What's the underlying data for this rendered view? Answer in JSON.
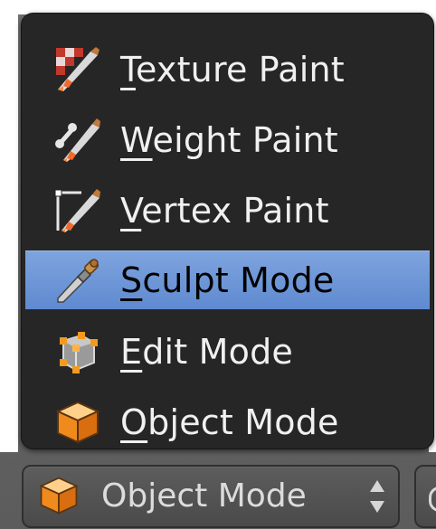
{
  "menu": {
    "items": [
      {
        "underline": "T",
        "rest": "exture Paint",
        "icon": "texture-paint-icon",
        "active": false
      },
      {
        "underline": "W",
        "rest": "eight Paint",
        "icon": "weight-paint-icon",
        "active": false
      },
      {
        "underline": "V",
        "rest": "ertex Paint",
        "icon": "vertex-paint-icon",
        "active": false
      },
      {
        "underline": "S",
        "rest": "culpt Mode",
        "icon": "sculpt-mode-icon",
        "active": true
      },
      {
        "underline": "E",
        "rest": "dit Mode",
        "icon": "edit-mode-icon",
        "active": false
      },
      {
        "underline": "O",
        "rest": "bject Mode",
        "icon": "object-mode-icon",
        "active": false
      }
    ]
  },
  "header": {
    "mode_select": {
      "label": "Object Mode",
      "icon": "object-mode-icon"
    }
  },
  "colors": {
    "menu_bg": "#262626",
    "highlight": "#6f97d8",
    "text": "#f0f0f0",
    "header_bg": "#5d5d5d"
  }
}
